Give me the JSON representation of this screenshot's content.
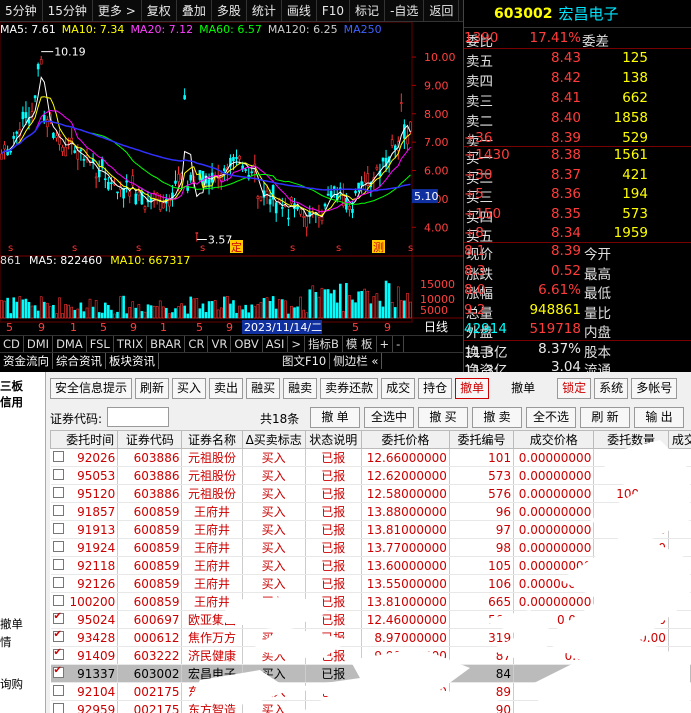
{
  "toolbar": {
    "items": [
      "5分钟",
      "15分钟",
      "更多 >",
      "复权",
      "叠加",
      "多股",
      "统计",
      "画线",
      "F10",
      "标记",
      "-自选",
      "返回"
    ]
  },
  "ma_legend": {
    "ma5": "MA5: 7.61",
    "ma10": "MA10: 7.34",
    "ma20": "MA20: 7.12",
    "ma60": "MA60: 6.57",
    "ma120": "MA120: 6.25",
    "ma250": "MA250"
  },
  "chart": {
    "price_high": "10.19",
    "price_low": "3.57",
    "current_mark": "5.10",
    "y_ticks": [
      "10.00",
      "9.00",
      "8.00",
      "7.00",
      "6.00",
      "5.00",
      "4.00"
    ],
    "vol_ticks": [
      "15000",
      "10000",
      "5000"
    ],
    "date_label": "2023/11/14/二",
    "event_labels": [
      "定",
      "测"
    ],
    "x_ticks": [
      "5",
      "9",
      "1",
      "5",
      "9",
      "1",
      "5",
      "9",
      "1",
      "5",
      "9"
    ],
    "right_label": "日线",
    "colors": {
      "ma5": "#ffffff",
      "ma10": "#ffff00",
      "ma20": "#ff00ff",
      "ma60": "#00ff00",
      "ma120": "#aaaaaa",
      "ma250": "#3030ff",
      "up": "#ff3232",
      "down": "#00ffff"
    }
  },
  "vol_legend": {
    "vol": "861",
    "ma5": "MA5: 822460",
    "ma10": "MA10: 667317"
  },
  "indicators": [
    "CD",
    "DMI",
    "DMA",
    "FSL",
    "TRIX",
    "BRAR",
    "CR",
    "VR",
    "OBV",
    "ASI",
    ">",
    "指标B",
    "模 板",
    "+",
    "-"
  ],
  "low_tabs": [
    "资金流向",
    "综合资讯",
    "板块资讯",
    "图文F10",
    "侧边栏 «"
  ],
  "quote": {
    "code": "603002",
    "name": "宏昌电子",
    "weibi_label": "委比",
    "weibi": "17.41%",
    "weicha_label": "委差",
    "weicha": "1390",
    "sells": [
      {
        "label": "卖五",
        "price": "8.43",
        "vol": "125",
        "chg": ""
      },
      {
        "label": "卖四",
        "price": "8.42",
        "vol": "138",
        "chg": ""
      },
      {
        "label": "卖三",
        "price": "8.41",
        "vol": "662",
        "chg": ""
      },
      {
        "label": "卖二",
        "price": "8.40",
        "vol": "1858",
        "chg": ""
      },
      {
        "label": "卖一",
        "price": "8.39",
        "vol": "529",
        "chg": "+36"
      }
    ],
    "buys": [
      {
        "label": "买一",
        "price": "8.38",
        "vol": "1561",
        "chg": "+1430"
      },
      {
        "label": "买二",
        "price": "8.37",
        "vol": "421",
        "chg": "+30"
      },
      {
        "label": "买三",
        "price": "8.36",
        "vol": "194",
        "chg": "+5"
      },
      {
        "label": "买四",
        "price": "8.35",
        "vol": "573",
        "chg": "+150"
      },
      {
        "label": "买五",
        "price": "8.34",
        "vol": "1959",
        "chg": "+8"
      }
    ],
    "stats": [
      {
        "l1": "现价",
        "v1": "8.39",
        "l2": "今开",
        "v2": "8.1"
      },
      {
        "l1": "涨跌",
        "v1": "0.52",
        "l2": "最高",
        "v2": "8.3"
      },
      {
        "l1": "涨幅",
        "v1": "6.61%",
        "l2": "最低",
        "v2": "8.0"
      },
      {
        "l1": "总量",
        "v1": "948861",
        "l2": "量比",
        "v2": "9.2"
      },
      {
        "l1": "外盘",
        "v1": "519718",
        "l2": "内盘",
        "v2": "42914"
      }
    ],
    "stats2": [
      {
        "l1": "换手",
        "v1": "8.37%",
        "l2": "股本",
        "v2": "11.3亿"
      },
      {
        "l1": "净资",
        "v1": "3.04",
        "l2": "流通",
        "v2": "11.3亿"
      }
    ]
  },
  "trade": {
    "left_menu": [
      "三板",
      "信用",
      "撤单",
      "情",
      "询购"
    ],
    "buttons": [
      "安全信息提示",
      "刷新",
      "买入",
      "卖出",
      "融买",
      "融卖",
      "卖券还款",
      "成交",
      "持仓",
      "撤单",
      "撤单",
      "锁定",
      "系统",
      "多帐号"
    ],
    "code_label": "证券代码:",
    "code_value": "",
    "total": "共18条",
    "actions": [
      "撤 单",
      "全选中",
      "撤 买",
      "撤 卖",
      "全不选",
      "刷 新",
      "输 出"
    ],
    "columns": [
      "委托时间",
      "证券代码",
      "证券名称",
      "Δ买卖标志",
      "状态说明",
      "委托价格",
      "委托编号",
      "成交价格",
      "委托数量",
      "成交"
    ],
    "rows": [
      {
        "checked": false,
        "time": "92026",
        "code": "603886",
        "name": "元祖股份",
        "side": "买入",
        "status": "已报",
        "price": "12.66000000",
        "no": "101",
        "deal": "0.00000000",
        "qty": "1000.00"
      },
      {
        "checked": false,
        "time": "95053",
        "code": "603886",
        "name": "元祖股份",
        "side": "买入",
        "status": "已报",
        "price": "12.62000000",
        "no": "573",
        "deal": "0.00000000",
        "qty": "1000.00"
      },
      {
        "checked": false,
        "time": "95120",
        "code": "603886",
        "name": "元祖股份",
        "side": "买入",
        "status": "已报",
        "price": "12.58000000",
        "no": "576",
        "deal": "0.00000000",
        "qty": "1000.00"
      },
      {
        "checked": false,
        "time": "91857",
        "code": "600859",
        "name": "王府井",
        "side": "买入",
        "status": "已报",
        "price": "13.88000000",
        "no": "96",
        "deal": "0.00000000",
        "qty": "1000.00"
      },
      {
        "checked": false,
        "time": "91913",
        "code": "600859",
        "name": "王府井",
        "side": "买入",
        "status": "已报",
        "price": "13.81000000",
        "no": "97",
        "deal": "0.00000000",
        "qty": "1000.00"
      },
      {
        "checked": false,
        "time": "91924",
        "code": "600859",
        "name": "王府井",
        "side": "买入",
        "status": "已报",
        "price": "13.77000000",
        "no": "98",
        "deal": "0.00000000",
        "qty": "1000.00"
      },
      {
        "checked": false,
        "time": "92118",
        "code": "600859",
        "name": "王府井",
        "side": "买入",
        "status": "已报",
        "price": "13.60000000",
        "no": "105",
        "deal": "0.00000000",
        "qty": "1000.00"
      },
      {
        "checked": false,
        "time": "92126",
        "code": "600859",
        "name": "王府井",
        "side": "买入",
        "status": "已报",
        "price": "13.55000000",
        "no": "106",
        "deal": "0.00000000",
        "qty": "1000.00"
      },
      {
        "checked": false,
        "time": "100200",
        "code": "600859",
        "name": "王府井",
        "side": "买入",
        "status": "已报",
        "price": "13.81000000",
        "no": "665",
        "deal": "0.00000000",
        "qty": "1000.00"
      },
      {
        "checked": true,
        "time": "95024",
        "code": "600697",
        "name": "欧亚集团",
        "side": "买入",
        "status": "已报",
        "price": "12.46000000",
        "no": "564",
        "deal": "0.000",
        "qty": "1000.00"
      },
      {
        "checked": true,
        "time": "93428",
        "code": "000612",
        "name": "焦作万方",
        "side": "买入",
        "status": "已报",
        "price": "8.97000000",
        "no": "319",
        "deal": "0.000",
        "qty": "1000.00"
      },
      {
        "checked": true,
        "time": "91409",
        "code": "603222",
        "name": "济民健康",
        "side": "买入",
        "status": "已报",
        "price": "9.90000000",
        "no": "87",
        "deal": "0.00",
        "qty": "1000.00"
      },
      {
        "checked": true,
        "time": "91337",
        "code": "603002",
        "name": "宏昌电子",
        "side": "买入",
        "status": "已报",
        "price": "8.00000000",
        "no": "84",
        "deal": "0.0",
        "qty": "1000.00",
        "selected": true
      },
      {
        "checked": false,
        "time": "92104",
        "code": "002175",
        "name": "东方智造",
        "side": "买入",
        "status": "已报",
        "price": "4.94000000",
        "no": "89",
        "deal": "0.00",
        "qty": "1000.00"
      },
      {
        "checked": false,
        "time": "92959",
        "code": "002175",
        "name": "东方智造",
        "side": "买入",
        "status": "已报",
        "price": "10.00000000",
        "no": "90",
        "deal": "0.00",
        "qty": "1000.00"
      }
    ]
  }
}
